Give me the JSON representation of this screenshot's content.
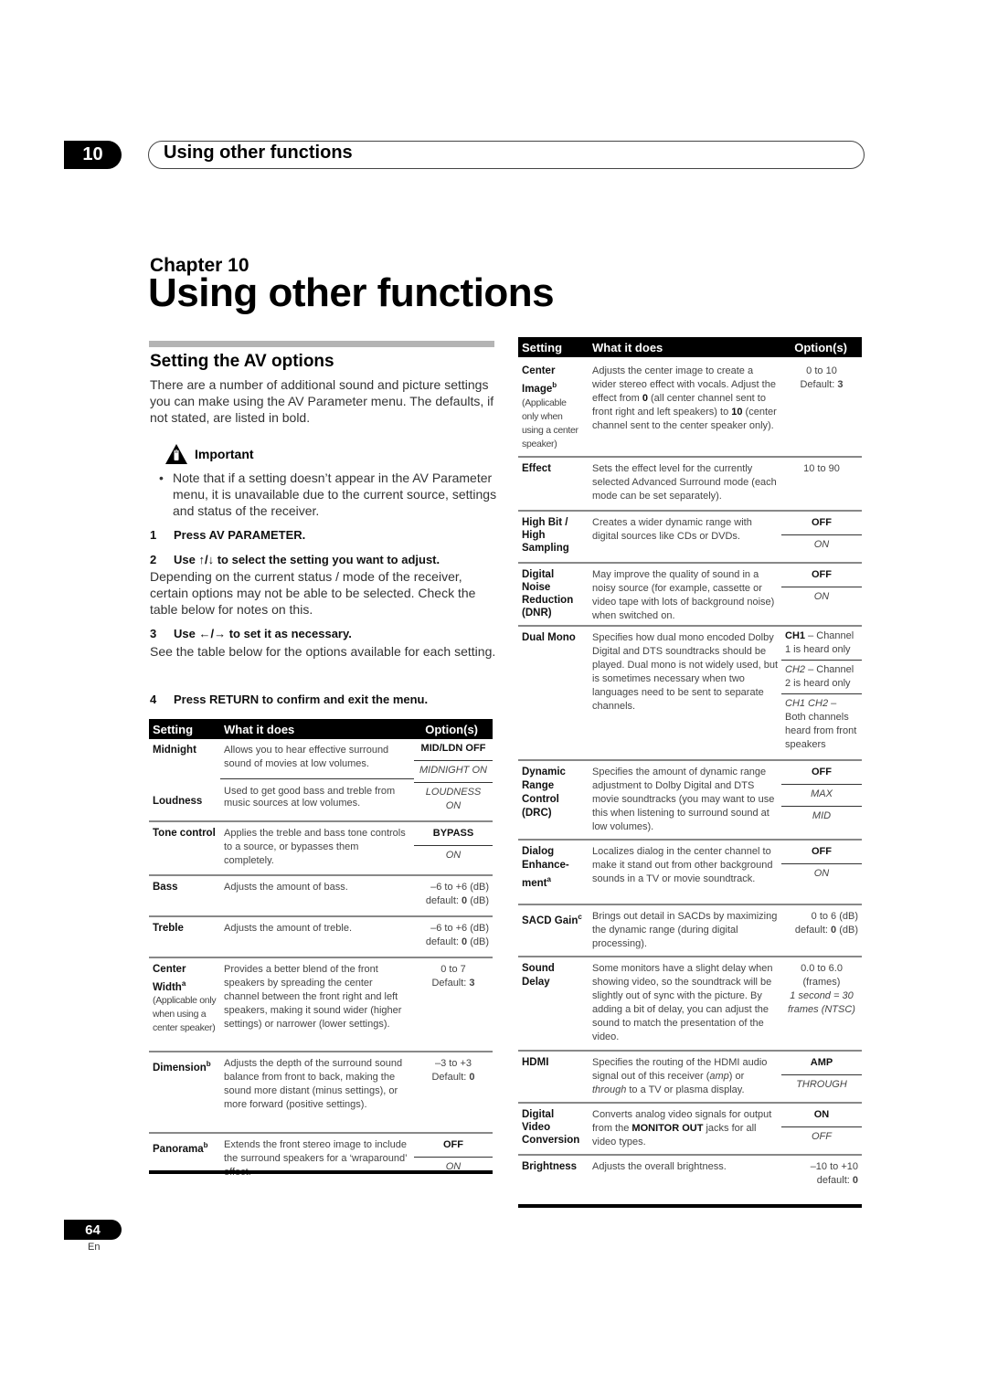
{
  "header": {
    "chapter_number": "10",
    "running_title": "Using other functions"
  },
  "chapter": {
    "label": "Chapter 10",
    "title": "Using other functions"
  },
  "section": {
    "title": "Setting the AV options",
    "intro": "There are a number of additional sound and picture settings you can make using the AV Parameter menu. The defaults, if not stated, are listed in bold.",
    "important_label": "Important",
    "important_icon": "warning-hand-icon",
    "important_note": "Note that if a setting doesn’t appear in the AV Parameter menu, it is unavailable due to the current source, settings and status of the receiver."
  },
  "steps": [
    {
      "num": "1",
      "head": "Press AV PARAMETER.",
      "body": ""
    },
    {
      "num": "2",
      "head_pre": "Use ",
      "arrows": "↑/↓",
      "head_post": " to select the setting you want to adjust.",
      "body": "Depending on the current status / mode of the receiver, certain options may not be able to be selected. Check the table below for notes on this."
    },
    {
      "num": "3",
      "head_pre": "Use ",
      "arrows": "←/→",
      "head_post": " to set it as necessary.",
      "body": "See the table below for the options available for each setting."
    },
    {
      "num": "4",
      "head": "Press RETURN to confirm and exit the menu.",
      "body": ""
    }
  ],
  "table_headers": {
    "setting": "Setting",
    "what": "What it does",
    "options": "Option(s)"
  },
  "left_table": {
    "midnight": {
      "setting": "Midnight",
      "desc": "Allows you to hear effective surround sound of movies at low volumes."
    },
    "loudness": {
      "setting": "Loudness",
      "desc": "Used to get good bass and treble from music sources at low volumes."
    },
    "midnight_loudness_options": [
      "MID/LDN OFF",
      "MIDNIGHT ON",
      "LOUDNESS ON"
    ],
    "tone": {
      "setting": "Tone control",
      "desc": "Applies the treble and bass tone controls to a source, or bypasses them completely.",
      "options": [
        "BYPASS",
        "ON"
      ]
    },
    "bass": {
      "setting": "Bass",
      "desc": "Adjusts the amount of bass.",
      "range": "–6 to +6 (dB)",
      "default_label": "default: ",
      "default_value": "0",
      "default_unit": " (dB)"
    },
    "treble": {
      "setting": "Treble",
      "desc": "Adjusts the amount of treble.",
      "range": "–6 to +6 (dB)",
      "default_label": "default: ",
      "default_value": "0",
      "default_unit": " (dB)"
    },
    "center_width": {
      "setting": "Center Width",
      "sup": "a",
      "note": "(Applicable only when using a center speaker)",
      "desc": "Provides a better blend of the front speakers by spreading the center channel between the front right and left speakers, making it sound wider (higher settings) or narrower (lower settings).",
      "range": "0 to 7",
      "default_label": "Default: ",
      "default_value": "3"
    },
    "dimension": {
      "setting": "Dimension",
      "sup": "b",
      "desc": "Adjusts the depth of the surround sound balance from front to back, making the sound more distant (minus settings), or more forward (positive settings).",
      "range": "–3 to +3",
      "default_label": "Default: ",
      "default_value": "0"
    },
    "panorama": {
      "setting": "Panorama",
      "sup": "b",
      "desc": "Extends the front stereo image to include the surround speakers for a ‘wraparound’ effect.",
      "options": [
        "OFF",
        "ON"
      ]
    }
  },
  "right_table": {
    "center_image": {
      "setting": "Center Image",
      "sup": "b",
      "note": "(Applicable only when using a center speaker)",
      "desc_1": "Adjusts the center image to create a wider stereo effect with vocals. Adjust the effect from ",
      "desc_b1": "0",
      "desc_2": " (all center channel sent to front right and left speakers) to ",
      "desc_b2": "10",
      "desc_3": " (center channel sent to the center speaker only).",
      "range": "0 to 10",
      "default_label": "Default: ",
      "default_value": "3"
    },
    "effect": {
      "setting": "Effect",
      "desc": "Sets the effect level for the currently selected Advanced Surround mode (each mode can be set separately).",
      "range": "10 to 90"
    },
    "high_bit": {
      "setting": "High Bit / High Sampling",
      "desc": "Creates a wider dynamic range with digital sources like CDs or DVDs.",
      "options": [
        "OFF",
        "ON"
      ]
    },
    "dnr": {
      "setting": "Digital Noise Reduction (DNR)",
      "desc": "May improve the quality of sound in a noisy source (for example, cassette or video tape with lots of background noise) when switched on.",
      "options": [
        "OFF",
        "ON"
      ]
    },
    "dual_mono": {
      "setting": "Dual Mono",
      "desc": "Specifies how dual mono encoded Dolby Digital and DTS soundtracks should be played. Dual mono is not widely used, but is sometimes necessary when two languages need to be sent to separate channels.",
      "options": [
        {
          "key": "CH1",
          "text": " – Channel 1 is heard only"
        },
        {
          "key": "CH2",
          "text": " – Channel 2 is heard only"
        },
        {
          "key": "CH1 CH2",
          "text": " – Both channels heard from front speakers"
        }
      ]
    },
    "drc": {
      "setting": "Dynamic Range Control (DRC)",
      "desc": "Specifies the amount of dynamic range adjustment to Dolby Digital and DTS movie soundtracks (you may want to use this when listening to surround sound at low volumes).",
      "options": [
        "OFF",
        "MAX",
        "MID"
      ]
    },
    "dialog": {
      "setting": "Dialog Enhance-ment",
      "sup": "a",
      "desc": "Localizes dialog in the center channel to make it stand out from other background sounds in a TV or movie soundtrack.",
      "options": [
        "OFF",
        "ON"
      ]
    },
    "sacd": {
      "setting": "SACD Gain",
      "sup": "c",
      "desc": "Brings out detail in SACDs by maximizing the dynamic range (during digital processing).",
      "range": "0 to 6 (dB)",
      "default_label": "default: ",
      "default_value": "0",
      "default_unit": " (dB)"
    },
    "sound_delay": {
      "setting": "Sound Delay",
      "desc": "Some monitors have a slight delay when showing video, so the soundtrack will be slightly out of sync with the picture. By adding a bit of delay, you can adjust the sound to match the presentation of the video.",
      "range": "0.0 to 6.0 (frames)",
      "note": "1 second = 30 frames (NTSC)"
    },
    "hdmi": {
      "setting": "HDMI",
      "desc_1": "Specifies the routing of the HDMI audio signal out of this receiver (",
      "desc_i1": "amp",
      "desc_2": ") or ",
      "desc_i2": "through",
      "desc_3": " to a TV or plasma display.",
      "options": [
        "AMP",
        "THROUGH"
      ]
    },
    "dvc": {
      "setting": "Digital Video Conversion",
      "desc_1": "Converts analog video signals for output from the ",
      "desc_b": "MONITOR OUT",
      "desc_2": " jacks for all video types.",
      "options": [
        "ON",
        "OFF"
      ]
    },
    "brightness": {
      "setting": "Brightness",
      "desc": "Adjusts the overall brightness.",
      "range": "–10 to +10",
      "default_label": "default: ",
      "default_value": "0"
    }
  },
  "footer": {
    "page_number": "64",
    "language": "En"
  }
}
